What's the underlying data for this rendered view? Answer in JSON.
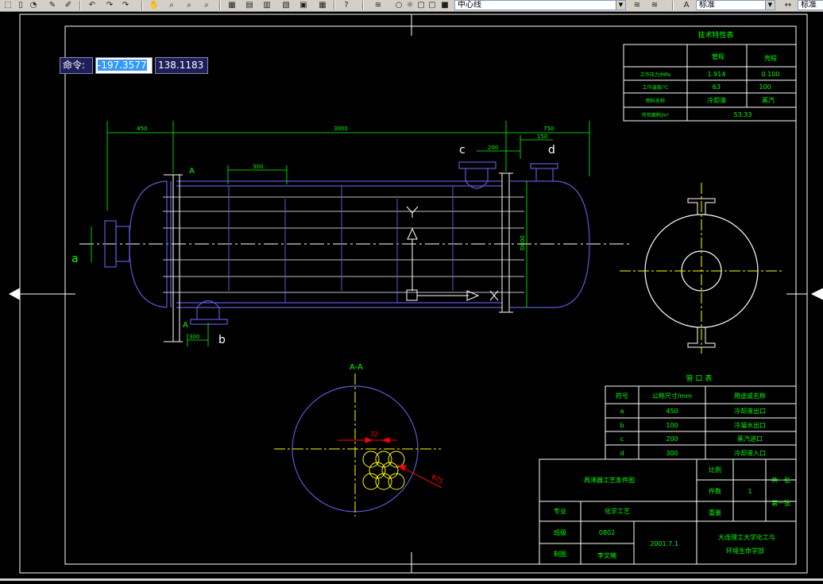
{
  "toolbar": {
    "layer_name": "中心线",
    "style_name": "标准",
    "style_name_right": "标准"
  },
  "command": {
    "label": "命令:",
    "x_value": "-197.3577",
    "y_value": "138.1183"
  },
  "drawing": {
    "views": {
      "main_labels": {
        "a": "a",
        "b": "b",
        "c": "c",
        "d": "d",
        "section_mark_top": "A",
        "section_mark_bottom": "A"
      },
      "section_title": "A-A",
      "section_dims": {
        "pitch": "32",
        "dia": "φ25"
      }
    },
    "dims": {
      "top_left": "450",
      "top_mid": "3000",
      "top_right": "750",
      "c_spacing": "200",
      "d_spacing": "150",
      "baffle": "300",
      "b_offset": "300",
      "height": "D800"
    },
    "tech_table": {
      "title": "技术特性表",
      "headers": [
        "",
        "管程",
        "壳程"
      ],
      "rows": [
        [
          "工作压力/MPa",
          "1.914",
          "0.100"
        ],
        [
          "工作温度/℃",
          "63",
          "100"
        ],
        [
          "物料名称",
          "冷却液",
          "蒸汽"
        ]
      ],
      "area_row": [
        "传热面积/m²",
        "53.33"
      ]
    },
    "nozzle_table": {
      "title": "管 口 表",
      "headers": [
        "符号",
        "公称尺寸/mm",
        "用途或名称"
      ],
      "rows": [
        [
          "a",
          "450",
          "冷却液出口"
        ],
        [
          "b",
          "100",
          "冷凝水出口"
        ],
        [
          "c",
          "200",
          "蒸汽进口"
        ],
        [
          "d",
          "300",
          "冷却液入口"
        ]
      ]
    },
    "title_block": {
      "drawing_name": "再沸器工艺条件图",
      "scale_label": "比例",
      "pieces_label": "件数",
      "pieces_value": "1",
      "weight_label": "重量",
      "total_sheets": "共一张",
      "sheet_no": "第一张",
      "major_label": "专业",
      "major_value": "化学工艺",
      "class_label": "班级",
      "class_value": "0802",
      "date": "2001.7.1",
      "drawer_label": "制图",
      "drawer_value": "李文楠",
      "school_line1": "大连理工大学化工与",
      "school_line2": "环境生命学部"
    }
  },
  "colors": {
    "background": "#000000",
    "outline": "#ffffff",
    "vessel": "#5a5ad6",
    "dimension": "#00ff00",
    "centerline": "#ffff00",
    "section_red": "#ff0000"
  }
}
